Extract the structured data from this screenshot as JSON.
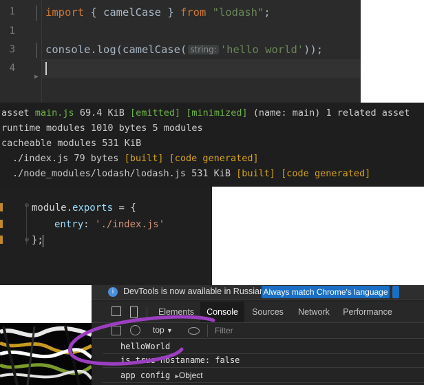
{
  "editor1": {
    "line_numbers": [
      "1",
      "1",
      "3",
      "4"
    ],
    "line1": {
      "kw1": "import",
      "p1": " { camelCase } ",
      "kw2": "from",
      "str": "\"lodash\"",
      "end": ";"
    },
    "line3": {
      "pre": "console.log(camelCase(",
      "hint": "string:",
      "str": "'hello world'",
      "end": "));"
    }
  },
  "terminal": {
    "asset": {
      "w1": "asset ",
      "name": "main.js",
      "size": " 69.4 KiB ",
      "emitted": "[emitted]",
      "minimized": "[minimized]",
      "rest": " (name: main) 1 related asset"
    },
    "runtime": "runtime modules 1010 bytes 5 modules",
    "cacheable": "cacheable modules 531 KiB",
    "mod1": {
      "path": "./index.js",
      "size": " 79 bytes ",
      "built": "[built]",
      "gen": "[code generated]"
    },
    "mod2": {
      "path": "./node_modules/lodash/lodash.js",
      "size": " 531 KiB ",
      "built": "[built]",
      "gen": "[code generated]"
    }
  },
  "editor2": {
    "line1": {
      "obj": "module.",
      "prop": "exports",
      "rest": " = {"
    },
    "line2": {
      "prop": "entry",
      "colon": ": ",
      "str": "'./index.js'"
    },
    "line3": "};"
  },
  "devtools": {
    "info_text": "DevTools is now available in Russian!",
    "info_button": "Always match Chrome's language",
    "tabs": [
      "Elements",
      "Console",
      "Sources",
      "Network",
      "Performance"
    ],
    "active_tab": "Console",
    "context": "top",
    "filter_placeholder": "Filter",
    "console_lines": [
      "helloWorld",
      "is true hostaname: false",
      "app config"
    ],
    "object_label": "Object"
  },
  "colors": {
    "annotation": "#9b3fc0",
    "button": "#1a6fc4"
  }
}
